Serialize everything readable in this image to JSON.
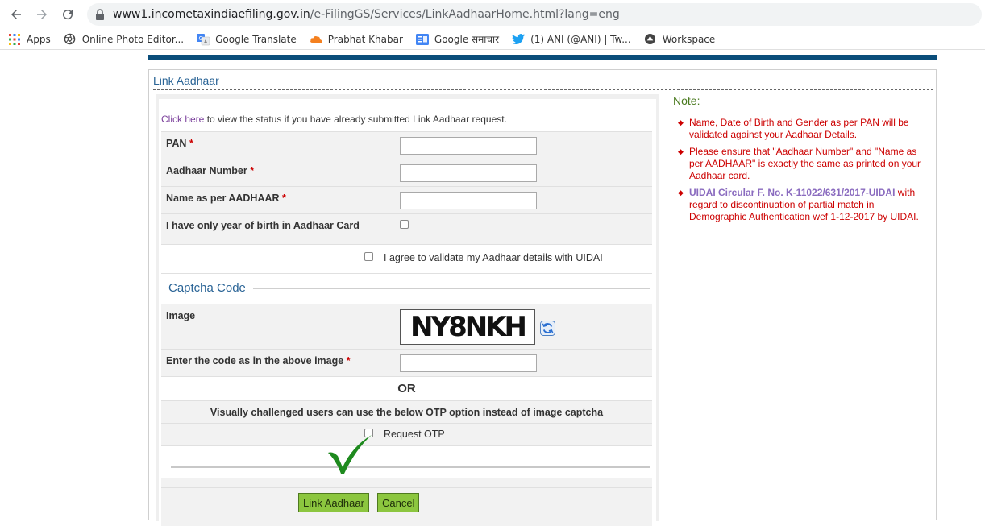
{
  "browser": {
    "url_host": "www1.incometaxindiaefiling.gov.in",
    "url_path": "/e-FilingGS/Services/LinkAadhaarHome.html?lang=eng",
    "bookmarks": [
      {
        "label": "Apps",
        "icon": "apps-grid-icon"
      },
      {
        "label": "Online Photo Editor...",
        "icon": "aperture-icon"
      },
      {
        "label": "Google Translate",
        "icon": "translate-icon"
      },
      {
        "label": "Prabhat Khabar",
        "icon": "cloud-icon"
      },
      {
        "label": "Google समाचार",
        "icon": "news-icon"
      },
      {
        "label": "(1) ANI (@ANI) | Tw...",
        "icon": "twitter-bird-icon"
      },
      {
        "label": "Workspace",
        "icon": "workspace-icon"
      }
    ]
  },
  "page": {
    "title": "Link Aadhaar",
    "status_link": "Click here",
    "status_text": " to view the status if you have already submitted Link Aadhaar request.",
    "fields": {
      "pan_label": "PAN",
      "aadhaar_label": "Aadhaar Number",
      "name_label": "Name as per AADHAAR",
      "yob_label": "I have only year of birth in Aadhaar Card",
      "required_mark": "*"
    },
    "agree_label": "I agree to validate my Aadhaar details with UIDAI",
    "captcha": {
      "title": "Captcha Code",
      "image_label": "Image",
      "image_text": "NY8NKH",
      "code_label": "Enter the code as in the above image"
    },
    "or_text": "OR",
    "visually_challenged_text": "Visually challenged users can use the below OTP option instead of image captcha",
    "otp_label": "Request OTP",
    "buttons": {
      "link": "Link Aadhaar",
      "cancel": "Cancel"
    },
    "note": {
      "title": "Note:",
      "items": [
        "Name, Date of Birth and Gender as per PAN will be validated against your Aadhaar Details.",
        "Please ensure that \"Aadhaar Number\" and \"Name as per AADHAAR\" is exactly the same as printed on your Aadhaar card."
      ],
      "circular_link": "UIDAI Circular F. No. K-11022/631/2017-UIDAI",
      "circular_text": " with regard to discontinuation of partial match in Demographic Authentication wef 1-12-2017 by UIDAI."
    }
  },
  "colors": {
    "accent_blue": "#2a6496",
    "top_bar": "#0a4d7a",
    "note_red": "#cc0000",
    "button_green": "#8cc63f",
    "checkmark_green": "#1e8a1e"
  }
}
